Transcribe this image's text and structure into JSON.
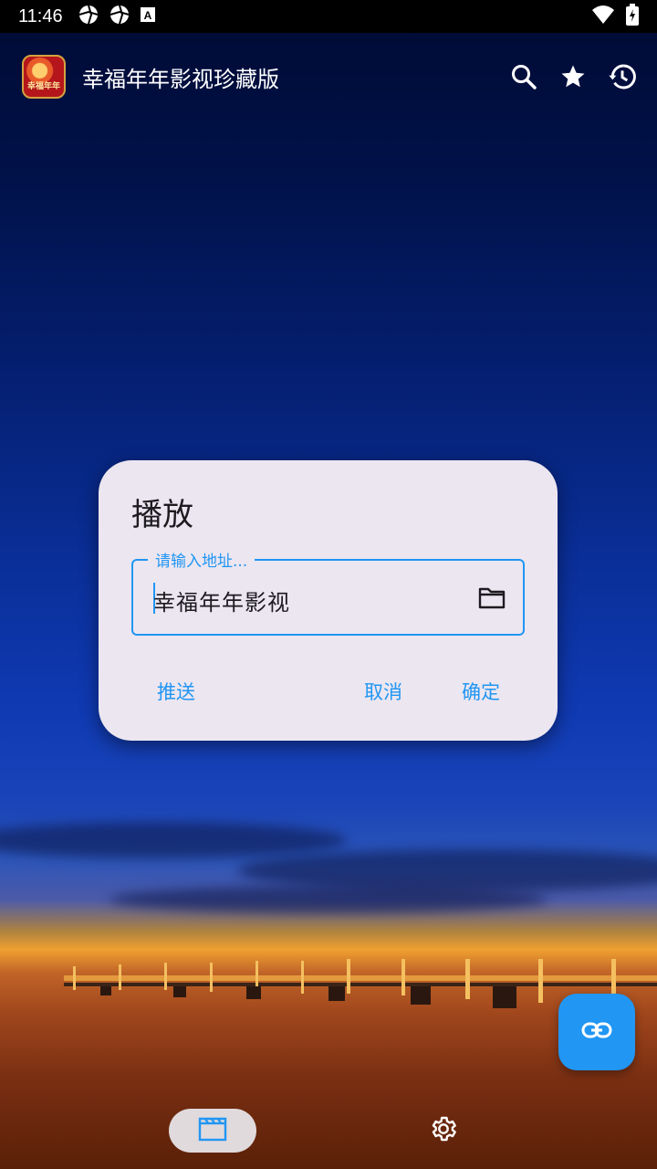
{
  "status_bar": {
    "time": "11:46",
    "left_icons": [
      "aperture-icon",
      "aperture-icon",
      "keyboard-a-icon"
    ],
    "right_icons": [
      "wifi-icon",
      "battery-charging-icon"
    ]
  },
  "app_bar": {
    "logo_text": "幸福年年",
    "title": "幸福年年影视珍藏版",
    "actions": [
      "search-icon",
      "star-icon",
      "history-icon"
    ]
  },
  "dialog": {
    "title": "播放",
    "field": {
      "label": "请输入地址...",
      "value": "幸福年年影视",
      "trailing_icon": "folder-icon"
    },
    "buttons": {
      "push": "推送",
      "cancel": "取消",
      "confirm": "确定"
    }
  },
  "fab": {
    "icon": "link-icon"
  },
  "bottom_nav": {
    "items": [
      {
        "icon": "clapperboard-icon",
        "selected": true
      },
      {
        "icon": "gear-icon",
        "selected": false
      }
    ]
  },
  "colors": {
    "accent": "#2196f3",
    "dialog_bg": "#ece6f0",
    "status_bar_bg": "#000000"
  }
}
